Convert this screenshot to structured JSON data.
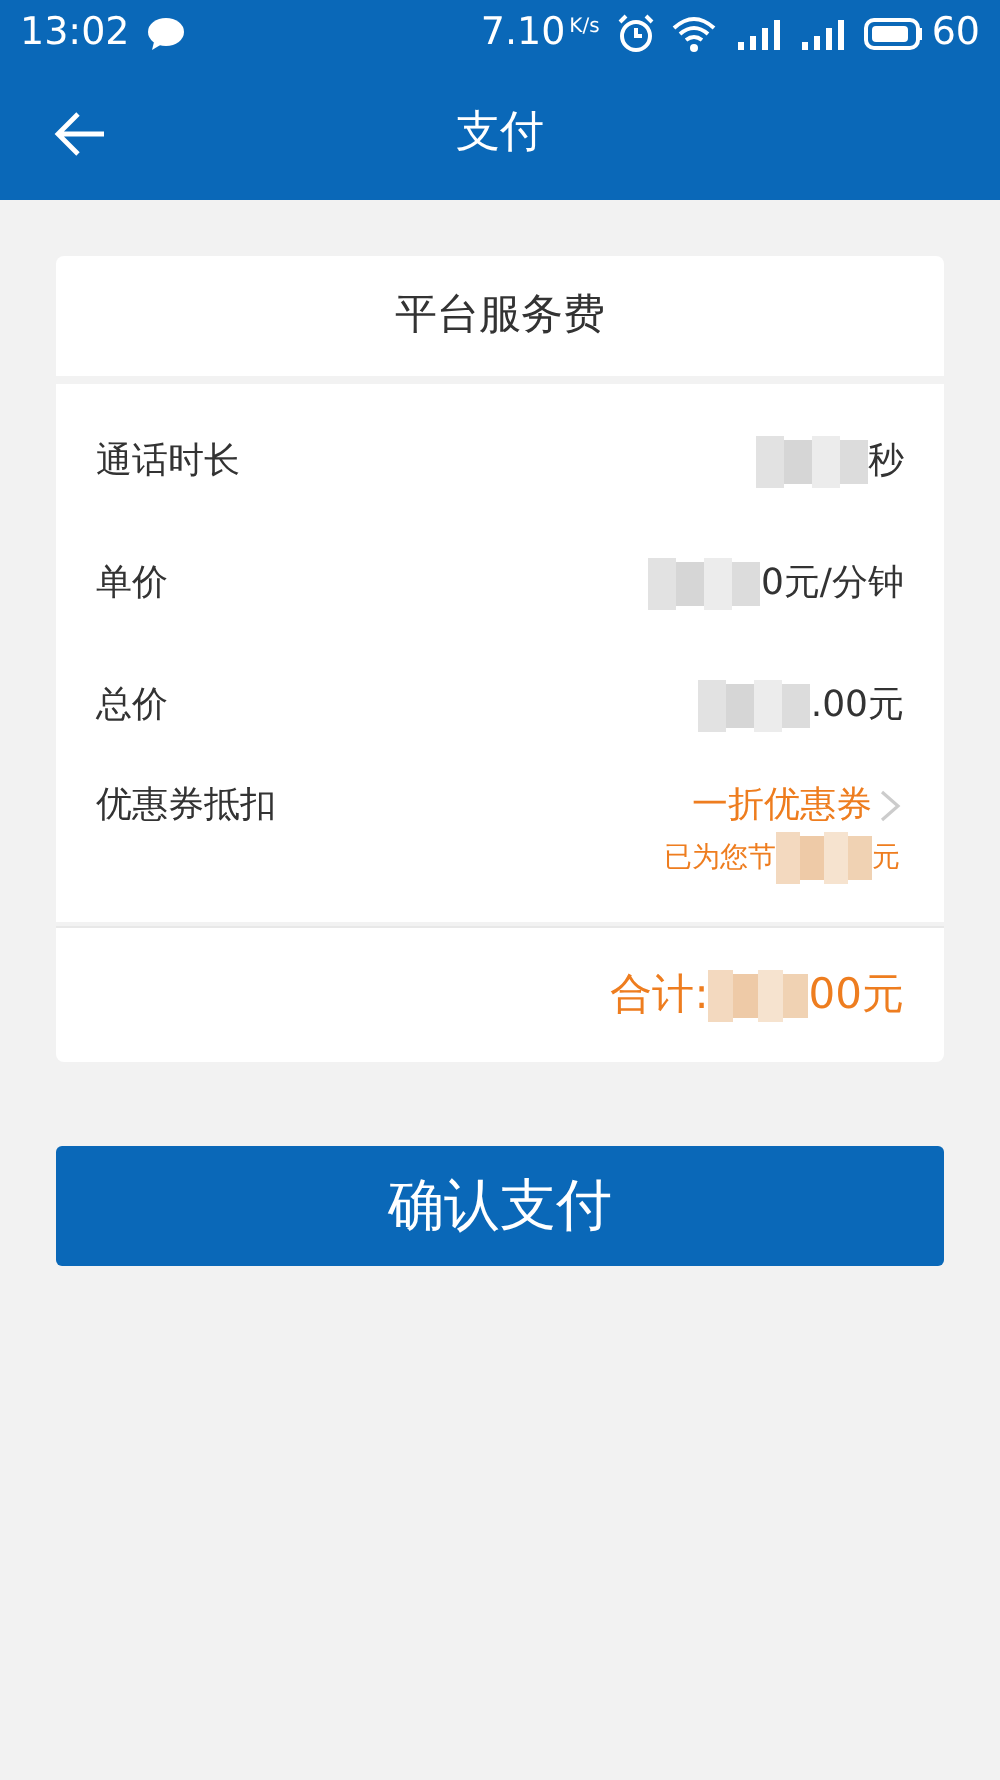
{
  "status_bar": {
    "time": "13:02",
    "speed": "7.10",
    "speed_unit": "K/s",
    "battery": "60"
  },
  "header": {
    "title": "支付"
  },
  "card": {
    "title": "平台服务费",
    "rows": [
      {
        "label": "通话时长",
        "after": "秒"
      },
      {
        "label": "单价",
        "after": "0元/分钟"
      },
      {
        "label": "总价",
        "after": ".00元"
      }
    ],
    "coupon": {
      "label": "优惠券抵扣",
      "value": "一折优惠券",
      "note_before": "已为您节",
      "note_after": "元"
    },
    "total": {
      "before": "合计:",
      "after": "00元"
    }
  },
  "confirm_button": "确认支付"
}
